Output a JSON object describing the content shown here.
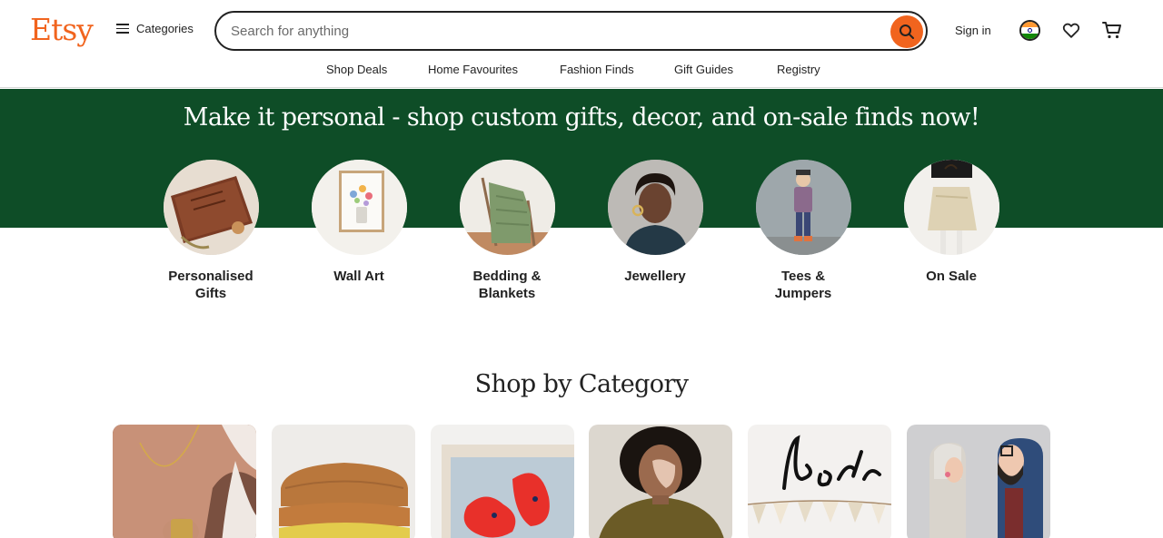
{
  "header": {
    "logo": "Etsy",
    "categories_label": "Categories",
    "search_placeholder": "Search for anything",
    "signin_label": "Sign in"
  },
  "subnav": [
    "Shop Deals",
    "Home Favourites",
    "Fashion Finds",
    "Gift Guides",
    "Registry"
  ],
  "banner": {
    "title": "Make it personal - shop custom gifts, decor, and on-sale finds now!",
    "color": "#0e4d27"
  },
  "featured": [
    {
      "label": "Personalised Gifts",
      "line1": "Personalised",
      "line2": "Gifts"
    },
    {
      "label": "Wall Art",
      "line1": "Wall Art",
      "line2": ""
    },
    {
      "label": "Bedding & Blankets",
      "line1": "Bedding &",
      "line2": "Blankets"
    },
    {
      "label": "Jewellery",
      "line1": "Jewellery",
      "line2": ""
    },
    {
      "label": "Tees & Jumpers",
      "line1": "Tees &",
      "line2": "Jumpers"
    },
    {
      "label": "On Sale",
      "line1": "On Sale",
      "line2": ""
    }
  ],
  "shop_by_category": {
    "title": "Shop by Category",
    "cards": [
      "jewellery-necklace",
      "knit-sweaters",
      "poppy-art-print",
      "portrait-woman",
      "name-sign",
      "wooden-figures"
    ]
  },
  "colors": {
    "brand": "#f1641e",
    "banner": "#0e4d27"
  }
}
